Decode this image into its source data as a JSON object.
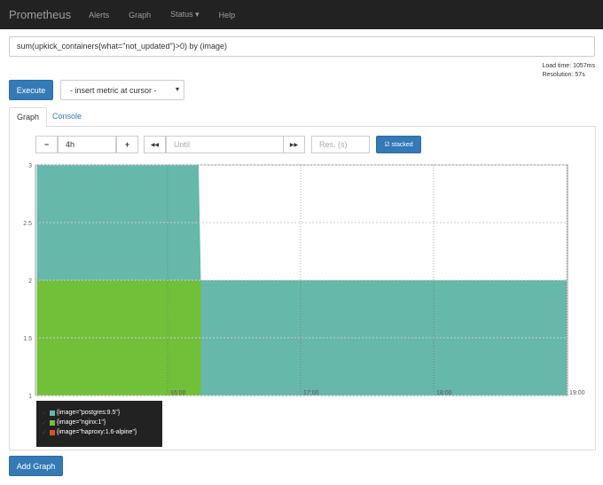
{
  "nav": {
    "brand": "Prometheus",
    "items": [
      "Alerts",
      "Graph",
      "Status ▾",
      "Help"
    ]
  },
  "query": "sum(upkick_containers{what=\"not_updated\"}>0) by (image)",
  "load_time": "Load time: 1057ms",
  "resolution": "Resolution: 57s",
  "execute_label": "Execute",
  "metric_select": "- insert metric at cursor -",
  "tabs": [
    "Graph",
    "Console"
  ],
  "controls": {
    "minus": "−",
    "range": "4h",
    "plus": "+",
    "back": "◀◀",
    "until_placeholder": "Until",
    "forward": "▶▶",
    "res_placeholder": "Res. (s)",
    "stacked": "☑ stacked"
  },
  "add_graph": "Add Graph",
  "chart_data": {
    "type": "area",
    "stacked": true,
    "ylim": [
      1,
      3
    ],
    "yticks": [
      "1",
      "1.5",
      "2",
      "2.5",
      "3"
    ],
    "xticks": [
      "16:00",
      "17:00",
      "18:00",
      "19:00"
    ],
    "grid": true,
    "series": [
      {
        "name": "{image=\"postgres:9.5\"}",
        "color": "#66b8ab",
        "points": [
          [
            "15:01",
            1
          ],
          [
            "16:14",
            1
          ],
          [
            "16:15",
            2
          ],
          [
            "19:00",
            2
          ]
        ]
      },
      {
        "name": "{image=\"nginx:1\"}",
        "color": "#72c03a",
        "points": [
          [
            "15:01",
            2
          ],
          [
            "16:15",
            2
          ]
        ]
      },
      {
        "name": "{image=\"haproxy:1.6-alpine\"}",
        "color": "#d8502f",
        "points": []
      }
    ],
    "legend": "bottom-left"
  }
}
